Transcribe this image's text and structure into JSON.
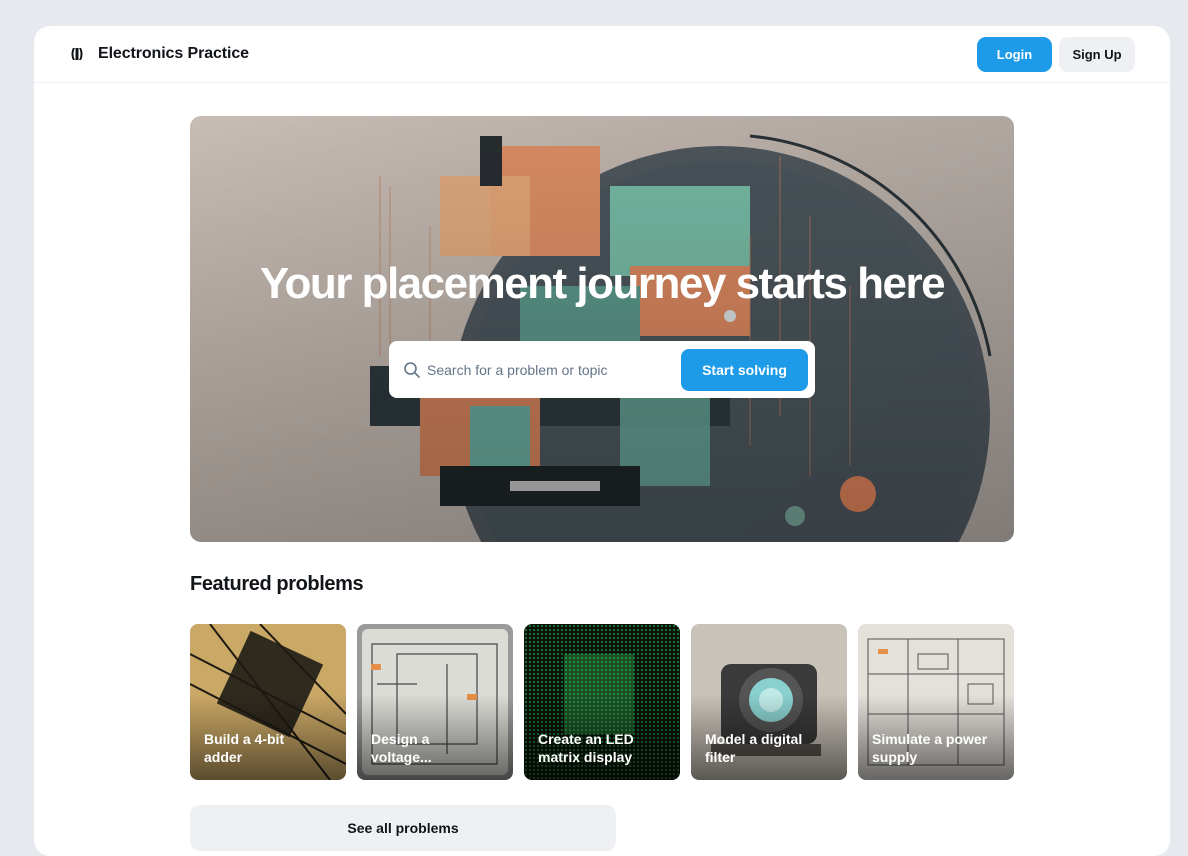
{
  "header": {
    "brand_title": "Electronics Practice",
    "logo_icon": "circuit-logo-icon",
    "login_label": "Login",
    "signup_label": "Sign Up"
  },
  "hero": {
    "title": "Your placement journey starts here",
    "search_placeholder": "Search for a problem or topic",
    "search_value": "",
    "search_icon": "search-icon",
    "cta_label": "Start solving"
  },
  "featured": {
    "title": "Featured problems",
    "cards": [
      {
        "label": "Build a 4-bit adder"
      },
      {
        "label": "Design a voltage..."
      },
      {
        "label": "Create an LED matrix display"
      },
      {
        "label": "Model a digital filter"
      },
      {
        "label": "Simulate a power supply"
      }
    ],
    "see_all_label": "See all problems"
  },
  "colors": {
    "accent": "#1d9be8",
    "secondary_button": "#eef0f3",
    "text": "#111418",
    "placeholder": "#637588"
  }
}
